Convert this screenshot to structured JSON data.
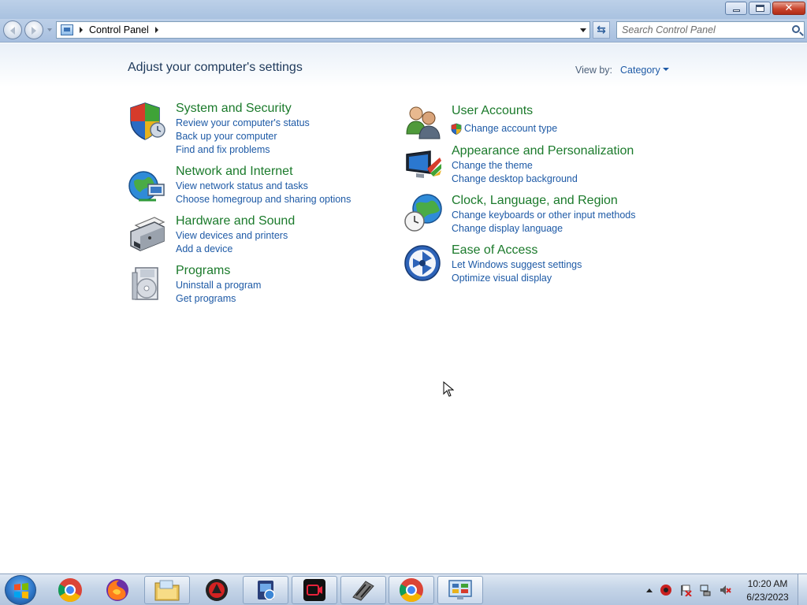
{
  "window": {
    "controls": {
      "minimize": "minimize",
      "maximize": "restore",
      "close": "close"
    }
  },
  "address_bar": {
    "crumbs": [
      "Control Panel"
    ],
    "search_placeholder": "Search Control Panel"
  },
  "main": {
    "heading": "Adjust your computer's settings",
    "view_by_label": "View by:",
    "view_by_value": "Category",
    "categories_left": [
      {
        "title": "System and Security",
        "icon": "shield-icon",
        "links": [
          "Review your computer's status",
          "Back up your computer",
          "Find and fix problems"
        ]
      },
      {
        "title": "Network and Internet",
        "icon": "globe-network-icon",
        "links": [
          "View network status and tasks",
          "Choose homegroup and sharing options"
        ]
      },
      {
        "title": "Hardware and Sound",
        "icon": "printer-icon",
        "links": [
          "View devices and printers",
          "Add a device"
        ]
      },
      {
        "title": "Programs",
        "icon": "programs-disc-icon",
        "links": [
          "Uninstall a program",
          "Get programs"
        ]
      }
    ],
    "categories_right": [
      {
        "title": "User Accounts",
        "icon": "users-icon",
        "links": [
          "Change account type"
        ]
      },
      {
        "title": "Appearance and Personalization",
        "icon": "monitor-paint-icon",
        "links": [
          "Change the theme",
          "Change desktop background"
        ]
      },
      {
        "title": "Clock, Language, and Region",
        "icon": "clock-globe-icon",
        "links": [
          "Change keyboards or other input methods",
          "Change display language"
        ]
      },
      {
        "title": "Ease of Access",
        "icon": "ease-of-access-icon",
        "links": [
          "Let Windows suggest settings",
          "Optimize visual display"
        ]
      }
    ]
  },
  "taskbar": {
    "apps": [
      "chrome-icon",
      "firefox-icon",
      "file-explorer-icon",
      "app-red-icon",
      "app-blue-icon",
      "screen-recorder-icon",
      "app-film-icon",
      "chrome-icon",
      "control-panel-icon"
    ],
    "clock_time": "10:20 AM",
    "clock_date": "6/23/2023"
  },
  "colors": {
    "category_title": "#1b7a2b",
    "link": "#1e5aa6",
    "heading": "#1e395b",
    "taskbar_top": "#dfe8f3"
  }
}
